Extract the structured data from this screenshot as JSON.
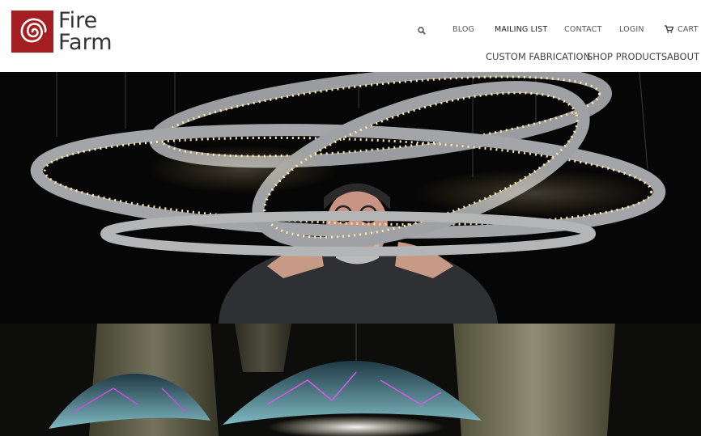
{
  "brand": {
    "line1": "Fire",
    "line2": "Farm",
    "color": "#a51e22"
  },
  "top_nav": {
    "search_icon": "search-icon",
    "blog": "BLOG",
    "mailing_list": "MAILING LIST",
    "contact": "CONTACT",
    "login": "LOGIN",
    "cart_icon": "cart-icon",
    "cart": "CART"
  },
  "main_nav": {
    "custom_fabrication": "CUSTOM FABRICATION",
    "shop_products": "SHOP PRODUCTS",
    "about": "ABOUT"
  },
  "hero": {
    "top_image": "ring-chandelier-photo",
    "bottom_image": "shell-lamps-photo"
  }
}
